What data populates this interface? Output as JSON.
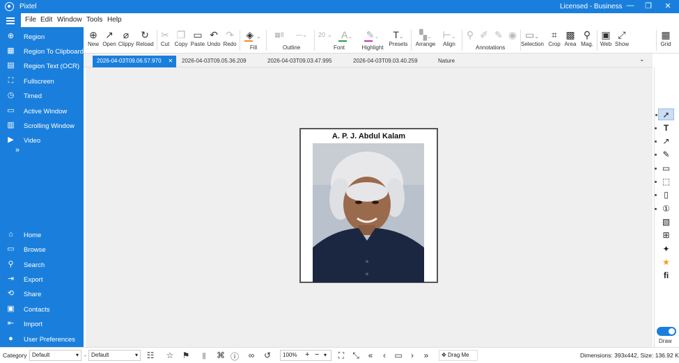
{
  "window": {
    "app_title": "Pixtel",
    "license": "Licensed - Business",
    "min": "—",
    "max": "❐",
    "close": "✕"
  },
  "menu": {
    "items": [
      "File",
      "Edit",
      "Window",
      "Tools",
      "Help"
    ]
  },
  "sidebar": {
    "capture_items": [
      {
        "label": "Region",
        "icon": "crosshair-icon"
      },
      {
        "label": "Region To Clipboard",
        "icon": "clipboard-region-icon"
      },
      {
        "label": "Region Text (OCR)",
        "icon": "document-text-icon"
      },
      {
        "label": "Fullscreen",
        "icon": "fullscreen-icon"
      },
      {
        "label": "Timed",
        "icon": "timer-icon"
      },
      {
        "label": "Active Window",
        "icon": "window-icon"
      },
      {
        "label": "Scrolling Window",
        "icon": "scroll-window-icon"
      },
      {
        "label": "Video",
        "icon": "video-icon"
      }
    ],
    "more": "»",
    "nav_items": [
      {
        "label": "Home",
        "icon": "home-icon"
      },
      {
        "label": "Browse",
        "icon": "folder-icon"
      },
      {
        "label": "Search",
        "icon": "search-icon"
      },
      {
        "label": "Export",
        "icon": "export-icon"
      },
      {
        "label": "Share",
        "icon": "share-icon"
      },
      {
        "label": "Contacts",
        "icon": "contacts-icon"
      },
      {
        "label": "Import",
        "icon": "import-icon"
      },
      {
        "label": "User Preferences",
        "icon": "user-icon"
      }
    ]
  },
  "ribbon": {
    "buttons": {
      "new": "New",
      "open": "Open",
      "clippy": "Clippy",
      "reload": "Reload",
      "cut": "Cut",
      "copy": "Copy",
      "paste": "Paste",
      "undo": "Undo",
      "redo": "Redo",
      "fill": "Fill",
      "outline": "Outline",
      "font": "Font",
      "highlight": "Highlight",
      "presets": "Presets",
      "arrange": "Arrange",
      "align": "Align",
      "annotations": "Annotations",
      "selection": "Selection",
      "crop": "Crop",
      "area": "Area",
      "mag": "Mag.",
      "web": "Web",
      "show": "Show",
      "grid": "Grid"
    },
    "outline_size": "8",
    "font_size": "20",
    "colors": {
      "fill": "#f08a24",
      "font": "#2a9d3a",
      "highlight": "#c32cc9",
      "accent": "#1a7fdc"
    }
  },
  "tabs": [
    {
      "label": "2026-04-03T09.06.57.970",
      "active": true,
      "close": "✕"
    },
    {
      "label": "2026-04-03T09.05.36.209"
    },
    {
      "label": "2026-04-03T09.03.47.995"
    },
    {
      "label": "2026-04-03T09.03.40.259"
    },
    {
      "label": "Nature"
    }
  ],
  "tabs_dropdown": "⌄",
  "document": {
    "title": "A. P. J. Abdul Kalam"
  },
  "right_toolbar": {
    "tools": [
      "pointer-icon",
      "text-icon",
      "arrow-icon",
      "pen-icon",
      "rectangle-icon",
      "selection-icon",
      "note-icon",
      "counter-icon",
      "image-icon",
      "table-icon",
      "magic-icon",
      "star-icon",
      "ligature-icon"
    ],
    "draw_label": "Draw"
  },
  "statusbar": {
    "category_label": "Category",
    "category_value": "Default",
    "preset_value": "Default",
    "zoom": "100%",
    "drag_label": "Drag Me",
    "dimensions": "Dimensions: 393x442, Size: 136.92 KB"
  }
}
